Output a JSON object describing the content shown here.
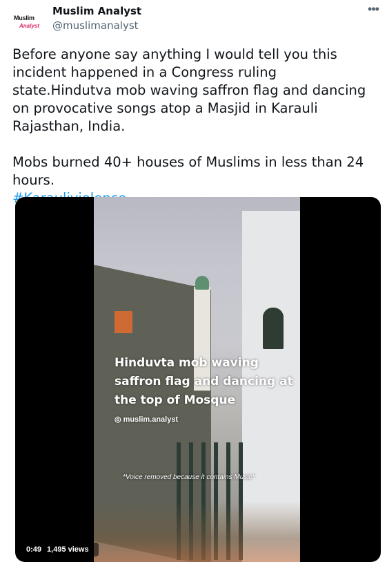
{
  "user": {
    "avatar_line1": "Muslim",
    "avatar_line2": "Analyst",
    "name": "Muslim Analyst",
    "handle": "@muslimanalyst"
  },
  "menu": {
    "more_label": "•••"
  },
  "tweet": {
    "text": "Before anyone say anything I would tell you this incident happened in a Congress ruling state.Hindutva mob waving saffron flag and dancing on provocative songs atop a Masjid in Karauli Rajasthan, India.\n\nMobs burned 40+ houses of Muslims in less than 24 hours.\n",
    "hashtag": "#Karauliviolence"
  },
  "video": {
    "overlay_title": "Hinduvta mob waving saffron flag and dancing at the top of Mosque",
    "overlay_credit": "◎ muslim.analyst",
    "overlay_note": "*Voice removed because it contains Music*",
    "duration": "0:49",
    "views": "1,495 views"
  },
  "colors": {
    "accent": "#1d9bf0",
    "text": "#0f1419",
    "secondary": "#536471",
    "avatar_accent": "#e0245e"
  }
}
